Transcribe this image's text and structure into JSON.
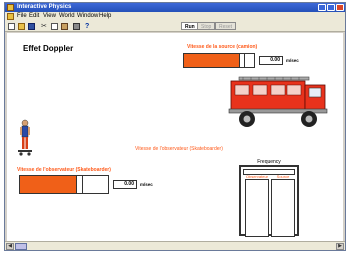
{
  "window": {
    "title": "Interactive Physics",
    "menu": [
      "File",
      "Edit",
      "View",
      "World",
      "Window",
      "Help"
    ]
  },
  "toolbar": {
    "tabs": [
      "Run",
      "Stop",
      "Reset"
    ],
    "active_tab": "Run"
  },
  "canvas": {
    "heading": "Effet Doppler",
    "source_speed": {
      "label": "Vitesse de la source (camion)",
      "value": "0.00",
      "unit": "m/sec",
      "fill_fraction": 0.78
    },
    "observer_speed": {
      "label": "Vitesse de l'observateur (Skateboarder)",
      "value": "0.00",
      "unit": "m/sec",
      "fill_fraction": 0.64
    },
    "center_label": "Vitesse de l'observateur (Skateboarder)",
    "frequency": {
      "title": "Frequency",
      "observer_label": "Observateur",
      "source_label": "Source"
    }
  },
  "colors": {
    "accent": "#f06018",
    "truck_red": "#e8321c",
    "label_orange": "#ff5a1a"
  }
}
